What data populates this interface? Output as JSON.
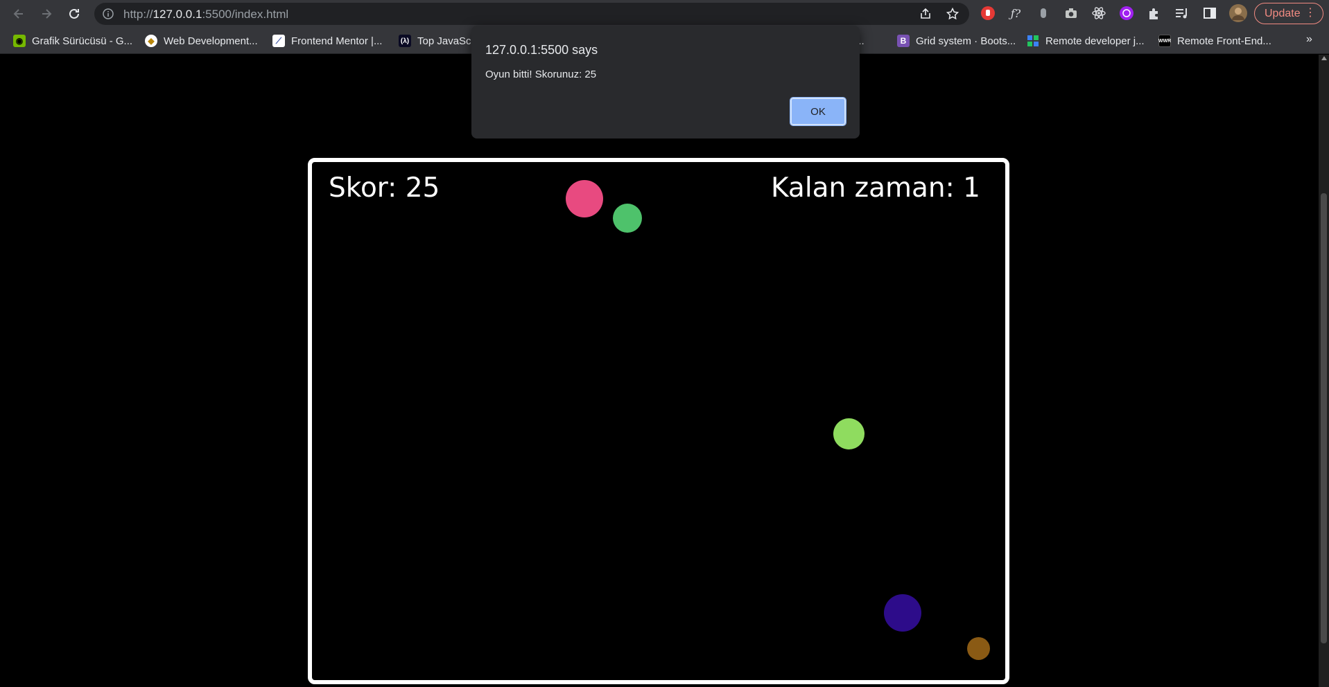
{
  "browser": {
    "url_scheme": "http://",
    "url_host": "127.0.0.1",
    "url_rest": ":5500/index.html",
    "update_label": "Update"
  },
  "bookmarks": [
    {
      "label": "Grafik Sürücüsü - G...",
      "icon": "nvidia-icon"
    },
    {
      "label": "Web Development...",
      "icon": "web-dev-icon"
    },
    {
      "label": "Frontend Mentor |...",
      "icon": "frontend-mentor-icon"
    },
    {
      "label": "Top JavaScr",
      "icon": "freecodecamp-icon"
    },
    {
      "label": "ss -...",
      "icon": "bookmark-icon"
    },
    {
      "label": "Grid system · Boots...",
      "icon": "bootstrap-icon"
    },
    {
      "label": "Remote developer j...",
      "icon": "remote-icon"
    },
    {
      "label": "Remote Front-End...",
      "icon": "wwr-icon"
    }
  ],
  "game": {
    "score_text": "Skor: 25",
    "time_text": "Kalan zaman: 1",
    "balls": [
      {
        "color": "#e84a80"
      },
      {
        "color": "#4ec26b"
      },
      {
        "color": "#8fdc5f"
      },
      {
        "color": "#2d0c8a"
      },
      {
        "color": "#8a5a14"
      }
    ]
  },
  "dialog": {
    "title": "127.0.0.1:5500 says",
    "message": "Oyun bitti! Skorunuz: 25",
    "ok_label": "OK"
  }
}
